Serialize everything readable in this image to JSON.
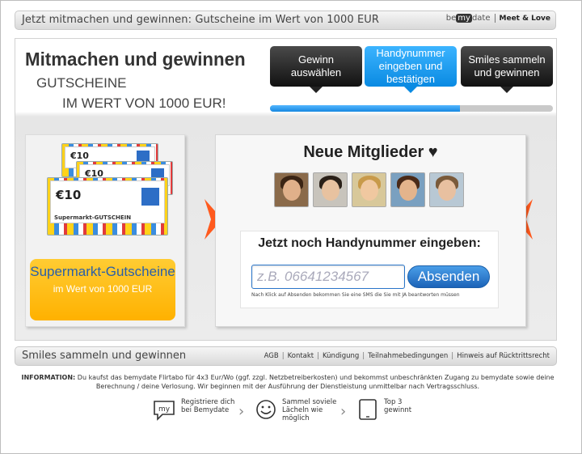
{
  "topbar": {
    "title": "Jetzt mitmachen und gewinnen: Gutscheine im Wert von 1000 EUR",
    "brand_logo_prefix": "be",
    "brand_logo_box": "my",
    "brand_logo_suffix": "date",
    "brand_slogan": "Meet & Love"
  },
  "headline": {
    "main": "Mitmachen und gewinnen",
    "sub1": "GUTSCHEINE",
    "sub2": "IM WERT VON 1000 EUR!"
  },
  "steps": [
    {
      "label": "Gewinn auswählen",
      "active": false
    },
    {
      "label": "Handynummer eingeben und bestätigen",
      "active": true
    },
    {
      "label": "Smiles sammeln und gewinnen",
      "active": false
    }
  ],
  "progress": {
    "fraction": 0.67
  },
  "voucher": {
    "amount": "€10",
    "label": "Supermarkt-GUTSCHEIN",
    "title": "Supermarkt-Gutscheine",
    "subtitle": "im Wert von 1000 EUR"
  },
  "members": {
    "title": "Neue Mitglieder ♥"
  },
  "phone": {
    "prompt": "Jetzt noch Handynummer eingeben:",
    "placeholder": "z.B. 06641234567",
    "button": "Absenden",
    "hint": "Nach Klick auf Absenden bekommen Sie eine SMS die Sie mit JA beantworten müssen"
  },
  "footer": {
    "title": "Smiles sammeln und gewinnen",
    "links": [
      "AGB",
      "Kontakt",
      "Kündigung",
      "Teilnahmebedingungen",
      "Hinweis auf Rücktrittsrecht"
    ],
    "info_label": "INFORMATION:",
    "info_text": "Du kaufst das bemydate Flirtabo für 4x3 Eur/Wo (ggf. zzgl. Netzbetreiberkosten) und bekommst unbeschränkten Zugang zu bemydate sowie deine Berechnung / deine Verlosung. Wir beginnen mit der Ausführung der Dienstleistung unmittelbar nach Vertragsschluss."
  },
  "how": {
    "step1_line1": "Registriere dich",
    "step1_line2": "bei Bemydate",
    "step1_icon_text": "my",
    "step2_line1": "Sammel soviele",
    "step2_line2": "Lächeln wie",
    "step2_line3": "möglich",
    "step3_line1": "Top 3",
    "step3_line2": "gewinnt"
  },
  "colors": {
    "accent_blue": "#1c8be0",
    "step_dark": "#1a1a1a",
    "voucher_yellow": "#ffbb11",
    "arrow_orange": "#ff5a1e"
  }
}
